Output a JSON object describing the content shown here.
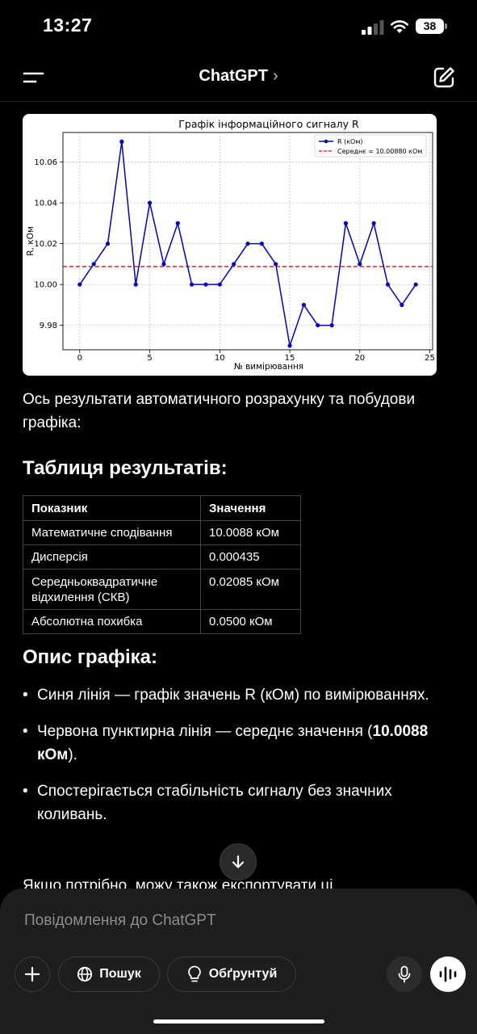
{
  "status_bar": {
    "time": "13:27",
    "battery": "38"
  },
  "header": {
    "title": "ChatGPT",
    "chevron": "›"
  },
  "chart_data": {
    "type": "line",
    "title": "Графік інформаційного сигналу R",
    "xlabel": "№ вимірювання",
    "ylabel": "R, кОм",
    "xlim": [
      -1.2,
      25.2
    ],
    "ylim": [
      9.968,
      10.0745
    ],
    "xticks": [
      0,
      5,
      10,
      15,
      20,
      25
    ],
    "yticks": [
      9.98,
      10.0,
      10.02,
      10.04,
      10.06
    ],
    "ytick_labels": [
      "9.98",
      "10.00",
      "10.02",
      "10.04",
      "10.06"
    ],
    "grid": true,
    "legend_position": "top-right",
    "series": [
      {
        "name": "R (кОм)",
        "color": "#0000cc",
        "x": [
          0,
          1,
          2,
          3,
          4,
          5,
          6,
          7,
          8,
          9,
          10,
          11,
          12,
          13,
          14,
          15,
          16,
          17,
          18,
          19,
          20,
          21,
          22,
          23,
          24
        ],
        "y": [
          10.0,
          10.01,
          10.02,
          10.07,
          10.0,
          10.04,
          10.01,
          10.03,
          10.0,
          10.0,
          10.0,
          10.01,
          10.02,
          10.02,
          10.01,
          9.97,
          9.99,
          9.98,
          9.98,
          10.03,
          10.01,
          10.03,
          10.0,
          9.99,
          10.0
        ]
      },
      {
        "name": "Середнє = 10.00880 кОм",
        "color": "#ff0000",
        "style": "dashed",
        "y_const": 10.0088
      }
    ]
  },
  "message": {
    "intro": "Ось результати автоматичного розрахунку та побудови графіка:",
    "table_heading": "Таблиця результатів:",
    "table": {
      "headers": [
        "Показник",
        "Значення"
      ],
      "rows": [
        [
          "Математичне сподівання",
          "10.0088 кОм"
        ],
        [
          "Дисперсія",
          "0.000435"
        ],
        [
          "Середньоквадратичне відхилення (СКВ)",
          "0.02085 кОм"
        ],
        [
          "Абсолютна похибка",
          "0.0500 кОм"
        ]
      ]
    },
    "desc_heading": "Опис графіка:",
    "bullets": [
      {
        "text": "Синя лінія — графік значень R (кОм) по вимірюваннях."
      },
      {
        "text_before": "Червона пунктирна лінія — середнє значення (",
        "bold": "10.0088 кОм",
        "text_after": ")."
      },
      {
        "text": "Спостерігається стабільність сигналу без значних коливань."
      }
    ],
    "trailing": "Якщо потрібно, можу також експортувати ці"
  },
  "composer": {
    "placeholder": "Повідомлення до ChatGPT",
    "search_label": "Пошук",
    "ground_label": "Обґрунтуй"
  }
}
